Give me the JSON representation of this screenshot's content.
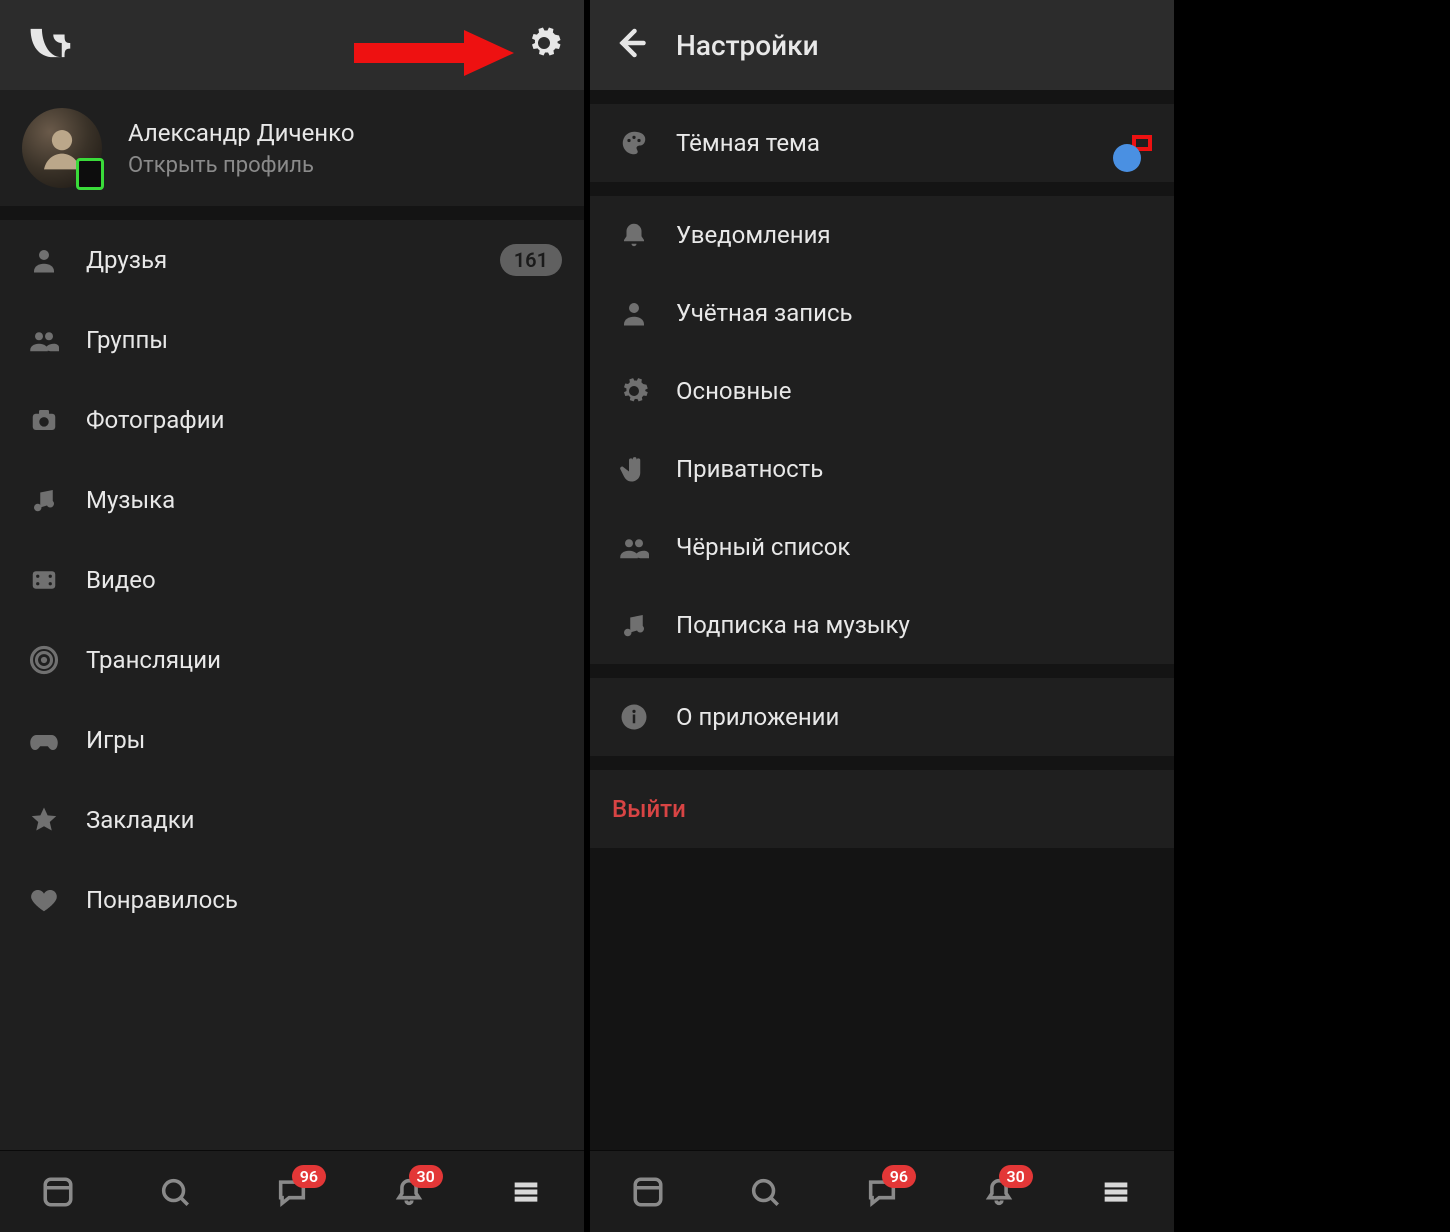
{
  "left": {
    "profile": {
      "name": "Александр Диченко",
      "subtitle": "Открыть профиль"
    },
    "menu": [
      {
        "icon": "person-icon",
        "label": "Друзья",
        "badge": "161"
      },
      {
        "icon": "group-icon",
        "label": "Группы",
        "badge": null
      },
      {
        "icon": "camera-icon",
        "label": "Фотографии",
        "badge": null
      },
      {
        "icon": "music-icon",
        "label": "Музыка",
        "badge": null
      },
      {
        "icon": "video-icon",
        "label": "Видео",
        "badge": null
      },
      {
        "icon": "broadcast-icon",
        "label": "Трансляции",
        "badge": null
      },
      {
        "icon": "games-icon",
        "label": "Игры",
        "badge": null
      },
      {
        "icon": "star-icon",
        "label": "Закладки",
        "badge": null
      },
      {
        "icon": "heart-icon",
        "label": "Понравилось",
        "badge": null
      }
    ]
  },
  "right": {
    "title": "Настройки",
    "theme_row": {
      "label": "Тёмная тема",
      "toggle_on": true
    },
    "rows": [
      {
        "icon": "bell-icon",
        "label": "Уведомления"
      },
      {
        "icon": "person-icon",
        "label": "Учётная запись"
      },
      {
        "icon": "gear-icon",
        "label": "Основные"
      },
      {
        "icon": "hand-icon",
        "label": "Приватность"
      },
      {
        "icon": "group-icon",
        "label": "Чёрный список"
      },
      {
        "icon": "music-icon",
        "label": "Подписка на музыку"
      }
    ],
    "about_label": "О приложении",
    "logout_label": "Выйти"
  },
  "bottom_nav": {
    "messages_badge": "96",
    "notifications_badge": "30"
  },
  "colors": {
    "highlight_box": "#e11b1b",
    "toggle_knob": "#4a90e2",
    "badge_red": "#e33737",
    "logout": "#d84444"
  }
}
